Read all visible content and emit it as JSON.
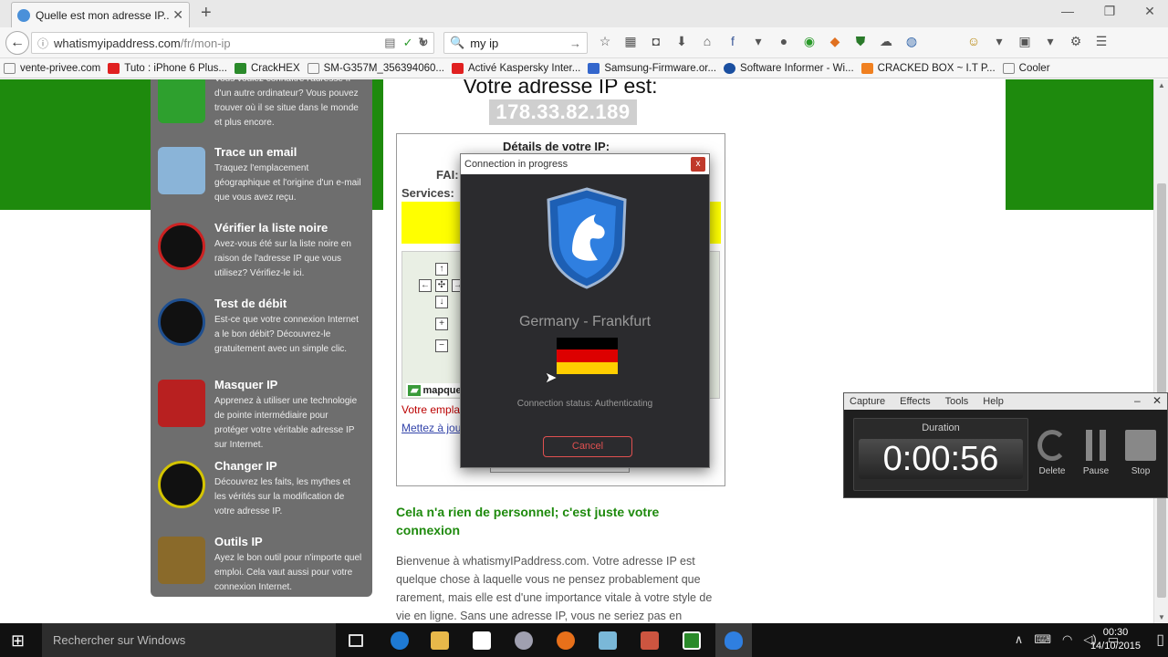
{
  "browser": {
    "tab_title": "Quelle est mon adresse IP...",
    "url_host": "whatismyipaddress.com",
    "url_path": "/fr/mon-ip",
    "search_value": "my ip"
  },
  "bookmarks": [
    {
      "label": "vente-privee.com",
      "color": "#fff"
    },
    {
      "label": "Tuto : iPhone 6 Plus...",
      "color": "#e02020"
    },
    {
      "label": "CrackHEX",
      "color": "#2a8a2a"
    },
    {
      "label": "SM-G357M_356394060...",
      "color": "#fff"
    },
    {
      "label": "Activé Kaspersky Inter...",
      "color": "#e02020"
    },
    {
      "label": "Samsung-Firmware.or...",
      "color": "#3366cc"
    },
    {
      "label": "Software Informer - Wi...",
      "color": "#1a4fa0"
    },
    {
      "label": "CRACKED BOX ~ I.T P...",
      "color": "#f08020"
    },
    {
      "label": "Cooler",
      "color": "#fff"
    }
  ],
  "sidebar": {
    "items": [
      {
        "title": "",
        "desc": "Vous voulez connaître l'adresse IP d'un autre ordinateur? Vous pouvez trouver où il se situe dans le monde et plus encore.",
        "color": "#2ea02e"
      },
      {
        "title": "Trace un email",
        "desc": "Traquez l'emplacement géographique et l'origine d'un e-mail que vous avez reçu.",
        "color": "#8ab4d8"
      },
      {
        "title": "Vérifier la liste noire",
        "desc": "Avez-vous été sur la liste noire en raison de l'adresse IP que vous utilisez? Vérifiez-le ici.",
        "color": "#cc2222"
      },
      {
        "title": "Test de débit",
        "desc": "Est-ce que votre connexion Internet a le bon débit? Découvrez-le gratuitement avec un simple clic.",
        "color": "#1f4f8f"
      },
      {
        "title": "Masquer IP",
        "desc": "Apprenez à utiliser une technologie de pointe intermédiaire pour protéger votre véritable adresse IP sur Internet.",
        "color": "#b82020"
      },
      {
        "title": "Changer IP",
        "desc": "Découvrez les faits, les mythes et les vérités sur la modification de votre adresse IP.",
        "color": "#d4c400"
      },
      {
        "title": "Outils IP",
        "desc": "Ayez le bon outil pour n'importe quel emploi. Cela vaut aussi pour votre connexion Internet.",
        "color": "#8a6a2a"
      }
    ]
  },
  "main": {
    "heading": "Votre adresse IP est:",
    "ip": "178.33.82.189",
    "details_title": "Détails de votre IP:",
    "fai_label": "FAI:",
    "services_label": "Services:",
    "map_logo": "mapque",
    "location_text": "Votre empla",
    "update_link": "Mettez à jou",
    "subheading": "Cela n'a rien de personnel; c'est juste votre connexion",
    "paragraph": "Bienvenue à whatismyIPaddress.com. Votre adresse IP est quelque chose à laquelle vous ne pensez probablement que rarement, mais elle est d'une importance vitale à votre style de vie en ligne. Sans une adresse IP, vous ne seriez pas en"
  },
  "dialog": {
    "title": "Connection in progress",
    "country": "Germany - Frankfurt",
    "status": "Connection status: Authenticating",
    "cancel": "Cancel",
    "flag_colors": [
      "#000000",
      "#dd0000",
      "#ffce00"
    ]
  },
  "recorder": {
    "menu": [
      "Capture",
      "Effects",
      "Tools",
      "Help"
    ],
    "duration_label": "Duration",
    "time": "0:00:56",
    "delete": "Delete",
    "pause": "Pause",
    "stop": "Stop"
  },
  "taskbar": {
    "search_placeholder": "Rechercher sur Windows",
    "time": "00:30",
    "date": "14/10/2015"
  }
}
